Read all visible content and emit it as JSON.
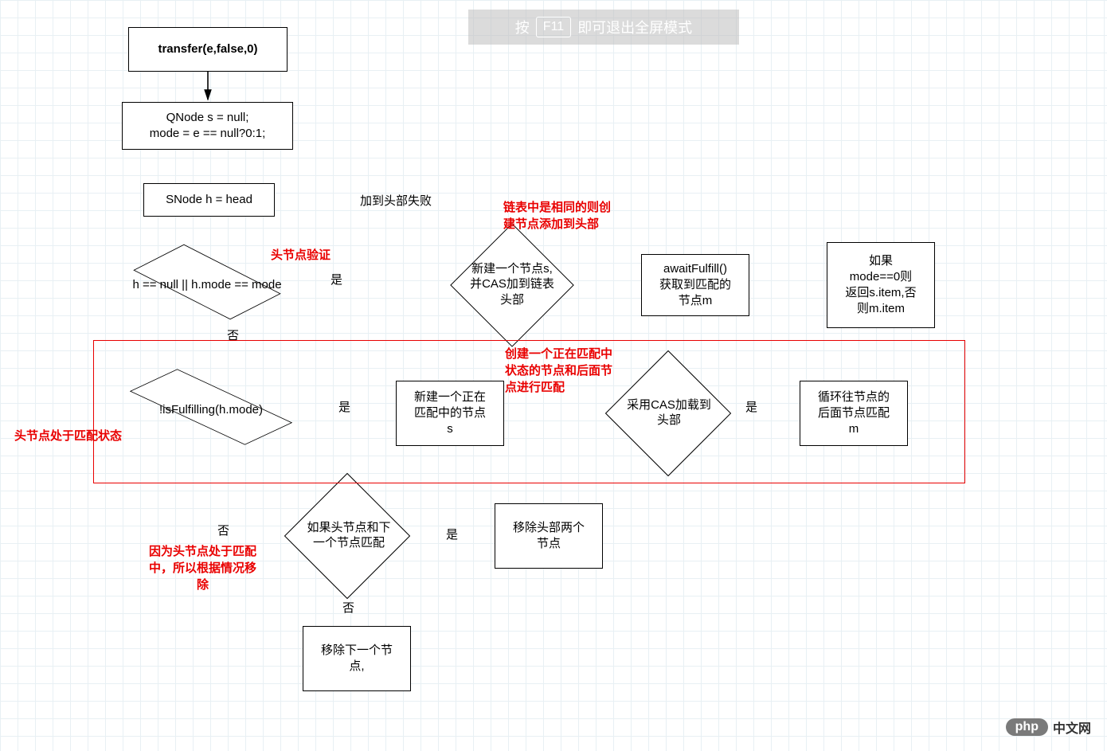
{
  "overlay": {
    "pre": "按",
    "key": "F11",
    "post": "即可退出全屏模式"
  },
  "nodes": {
    "transfer": "transfer(e,false,0)",
    "init": "QNode s = null;\nmode = e == null?0:1;",
    "snode": "SNode h = head",
    "decision1": "h == null || h.mode == mode",
    "decision2": "新建一个节点s,\n并CAS加到链表\n头部",
    "awaitFulfill": "awaitFulfill()\n获取到匹配的\n节点m",
    "result": "如果\nmode==0则\n返回s.item,否\n则m.item",
    "isFulfilling": "!isFulfilling(h.mode)",
    "newMatching": "新建一个正在\n匹配中的节点\ns",
    "casHead": "采用CAS加载到\n头部",
    "loopMatch": "循环往节点的\n后面节点匹配\nm",
    "headNextMatch": "如果头节点和下\n一个节点匹配",
    "removeTwo": "移除头部两个\n节点",
    "removeNext": "移除下一个节\n点,"
  },
  "annotations": {
    "headVerify": "头节点验证",
    "sameHead": "链表中是相同的则创\n建节点添加到头部",
    "matching": "创建一个正在匹配中\n状态的节点和后面节\n点进行匹配",
    "headMatchState": "头节点处于匹配状态",
    "becauseHead": "因为头节点处于匹配\n中，所以根据情况移\n除"
  },
  "labels": {
    "yes": "是",
    "no": "否",
    "addHeadFail": "加到头部失败"
  },
  "watermark": {
    "php": "php",
    "text": "中文网"
  }
}
